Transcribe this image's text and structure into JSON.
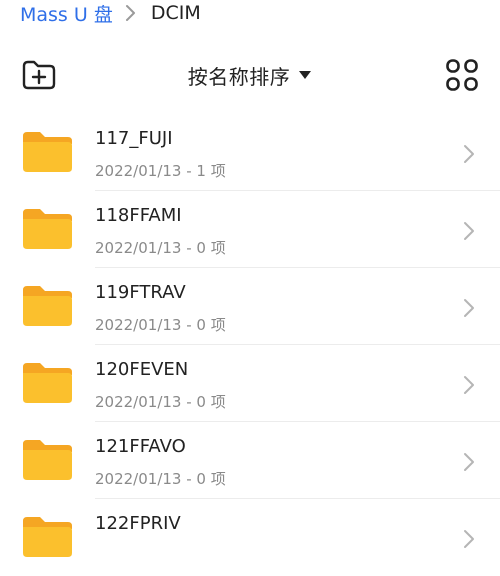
{
  "breadcrumb": {
    "root": "Mass U 盘",
    "current": "DCIM"
  },
  "toolbar": {
    "sort_label": "按名称排序",
    "new_folder_icon": "new-folder-icon",
    "view_icon": "grid-view-icon"
  },
  "colors": {
    "accent": "#2f6fe8",
    "folder": "#fbc02d",
    "folder_tab": "#f5a623"
  },
  "files": [
    {
      "name": "117_FUJI",
      "meta": "2022/01/13 - 1 项"
    },
    {
      "name": "118FFAMI",
      "meta": "2022/01/13 - 0 项"
    },
    {
      "name": "119FTRAV",
      "meta": "2022/01/13 - 0 项"
    },
    {
      "name": "120FEVEN",
      "meta": "2022/01/13 - 0 项"
    },
    {
      "name": "121FFAVO",
      "meta": "2022/01/13 - 0 项"
    },
    {
      "name": "122FPRIV",
      "meta": ""
    }
  ]
}
